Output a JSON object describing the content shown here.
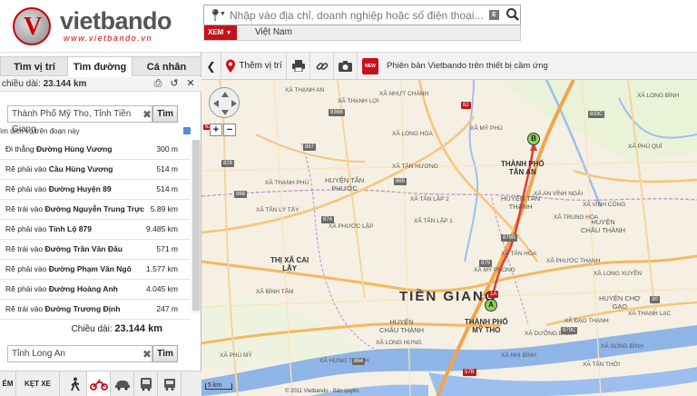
{
  "brand": {
    "name": "vietbando",
    "url": "www.vietbando.vn"
  },
  "search": {
    "placeholder": "Nhập vào địa chỉ, doanh nghiệp hoặc số điện thoại...",
    "xem_label": "XEM",
    "region": "Việt Nam"
  },
  "tabs": [
    {
      "label": "Tìm vị trí"
    },
    {
      "label": "Tìm đường"
    },
    {
      "label": "Cá nhân"
    }
  ],
  "summary": {
    "prefix": "chiều dài:",
    "value": "23.144 km"
  },
  "origin": {
    "value": "Thành Phố Mỹ Tho, Tỉnh Tiền Giang",
    "button": "Tìm"
  },
  "services_label": "ìm dịch vụ trên đoạn này",
  "steps": [
    {
      "action": "Đi thẳng",
      "road": "Đường Hùng Vương",
      "distance": "300 m"
    },
    {
      "action": "Rẽ phải vào",
      "road": "Cầu Hùng Vương",
      "distance": "514 m"
    },
    {
      "action": "Rẽ phải vào",
      "road": "Đường Huyện 89",
      "distance": "514 m"
    },
    {
      "action": "Rẽ trái vào",
      "road": "Đường Nguyễn Trung Trực",
      "distance": "5.89 km"
    },
    {
      "action": "Rẽ phải vào",
      "road": "Tỉnh Lộ 879",
      "distance": "9.485 km"
    },
    {
      "action": "Rẽ trái vào",
      "road": "Đường Trần Văn Đấu",
      "distance": "571 m"
    },
    {
      "action": "Rẽ phải vào",
      "road": "Đường Phạm Văn Ngô",
      "distance": "1.577 km"
    },
    {
      "action": "Rẽ phải vào",
      "road": "Đường Hoàng Anh",
      "distance": "4.045 km"
    },
    {
      "action": "Rẽ trái vào",
      "road": "Đường Trương Định",
      "distance": "247 m"
    }
  ],
  "total": {
    "prefix": "Chiều dài:",
    "value": "23.144 km"
  },
  "destination": {
    "value": "Tỉnh Long An",
    "button": "Tìm"
  },
  "bottom_bar": {
    "left_label": "ÉM",
    "ket_xe": "KẸT XE"
  },
  "toolbar": {
    "them_vi_tri": "Thêm vị trí",
    "new_badge": "NEW",
    "banner": "Phiên bản Vietbando trên thiết bị cầm ứng"
  },
  "map": {
    "zoom_level": "62",
    "scale": "5 km",
    "copyright": "© 2011 Vietbando - Bản quyền",
    "province": "TIỀN GIANG",
    "markers": [
      {
        "label": "A"
      },
      {
        "label": "B"
      }
    ],
    "districts": [
      {
        "text": "HUYỆN TÂN\nPHƯỚC"
      },
      {
        "text": "HUYỆN\nCHÂU THÀNH"
      },
      {
        "text": "HUYỆN TÂN\nTHẠNH"
      },
      {
        "text": "HUYỆN\nCHÂU THÀNH"
      },
      {
        "text": "HUYỆN CHỢ\nGẠO"
      }
    ],
    "cities": [
      {
        "text": "THÀNH PHỐ\nTÂN AN"
      },
      {
        "text": "THÀNH PHỐ\nMỸ THO"
      },
      {
        "text": "THỊ XÃ CAI\nLẬY"
      }
    ],
    "places": [
      {
        "text": "XÃ THẠNH AN"
      },
      {
        "text": "XÃ THẠNH LỢI"
      },
      {
        "text": "XÃ NHỰT CHÁNH"
      },
      {
        "text": "XÃ MỸ PHÚ"
      },
      {
        "text": "XÃ LONG HÒA"
      },
      {
        "text": "XÃ TÂN LẬP 2"
      },
      {
        "text": "XÃ TÂN LẬP 1"
      },
      {
        "text": "XÃ PHƯỚC LẬP"
      },
      {
        "text": "XÃ TÂN HÒA"
      },
      {
        "text": "XÃ TRUNG HÒA"
      },
      {
        "text": "XÃ VĨNH CÔNG"
      },
      {
        "text": "XÃ LONG XUYÊN"
      },
      {
        "text": "XÃ TÂN HƯƠNG"
      },
      {
        "text": "XÃ THẠNH PHÚ"
      },
      {
        "text": "XÃ MỸ PHONG"
      },
      {
        "text": "XÃ PHƯỚC THẠNH"
      },
      {
        "text": "XÃ ĐẠO THẠNH"
      },
      {
        "text": "XÃ SONG BÌNH"
      },
      {
        "text": "XÃ THANH LẠC"
      },
      {
        "text": "XÃ LONG BÌNH"
      },
      {
        "text": "XÃ PHÚ QUÍ"
      },
      {
        "text": "XÃ TÂN LÝ TÂY"
      },
      {
        "text": "XÃ LONG HƯNG"
      },
      {
        "text": "XÃ NHỊ BÌNH"
      },
      {
        "text": "XÃ DƯỠNG ĐIỀM"
      },
      {
        "text": "XÃ AN VĨNH NGÃI"
      },
      {
        "text": "XÃ BÌNH TÂM"
      },
      {
        "text": "XÃ HƯNG THẠNH"
      },
      {
        "text": "XÃ PHÚ MỸ"
      },
      {
        "text": "XÃ TÂN THỚI"
      }
    ],
    "shields": [
      {
        "text": "836B"
      },
      {
        "text": "867"
      },
      {
        "text": "865"
      },
      {
        "text": "829"
      },
      {
        "text": "868"
      },
      {
        "text": "874"
      },
      {
        "text": "879"
      },
      {
        "text": "878B"
      },
      {
        "text": "1A"
      },
      {
        "text": "62"
      },
      {
        "text": "833C"
      },
      {
        "text": "879C"
      },
      {
        "text": "864"
      },
      {
        "text": "57B"
      },
      {
        "text": "30"
      }
    ]
  }
}
